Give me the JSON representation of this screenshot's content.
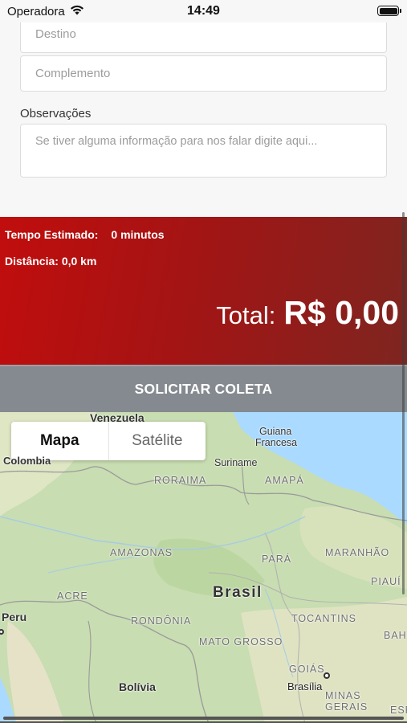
{
  "status": {
    "carrier": "Operadora",
    "time": "14:49"
  },
  "form": {
    "destino_placeholder": "Destino",
    "complemento_placeholder": "Complemento",
    "observacoes_label": "Observações",
    "observacoes_placeholder": "Se tiver alguma informação para nos falar digite aqui..."
  },
  "estimate": {
    "time_label": "Tempo Estimado:",
    "time_value": "0 minutos",
    "distance_label": "Distância:",
    "distance_value": "0,0 km",
    "total_label": "Total:",
    "total_value": "R$ 0,00",
    "gradient_start": "#c10d0d",
    "gradient_end": "#7e2520"
  },
  "button": {
    "label": "SOLICITAR COLETA",
    "color": "#858a90"
  },
  "map": {
    "toggle": {
      "active": "Mapa",
      "inactive": "Satélite"
    },
    "labels": {
      "venezuela": "Venezuela",
      "guiana_francesa_1": "Guiana",
      "guiana_francesa_2": "Francesa",
      "suriname": "Suriname",
      "colombia": "Colombia",
      "roraima": "RORAIMA",
      "amapa": "AMAPÁ",
      "amazonas": "AMAZONAS",
      "para": "PARÁ",
      "maranhao": "MARANHÃO",
      "piaui": "PIAUÍ",
      "acre": "ACRE",
      "brasil": "Brasil",
      "peru": "Peru",
      "rondonia": "RONDÔNIA",
      "tocantins": "TOCANTINS",
      "bahia": "BAH",
      "mato_grosso": "MATO GROSSO",
      "goias": "GOIÁS",
      "brasilia": "Brasília",
      "bolivia": "Bolívia",
      "minas_gerais": "MINAS GERAIS",
      "espirito": "ESP"
    }
  }
}
